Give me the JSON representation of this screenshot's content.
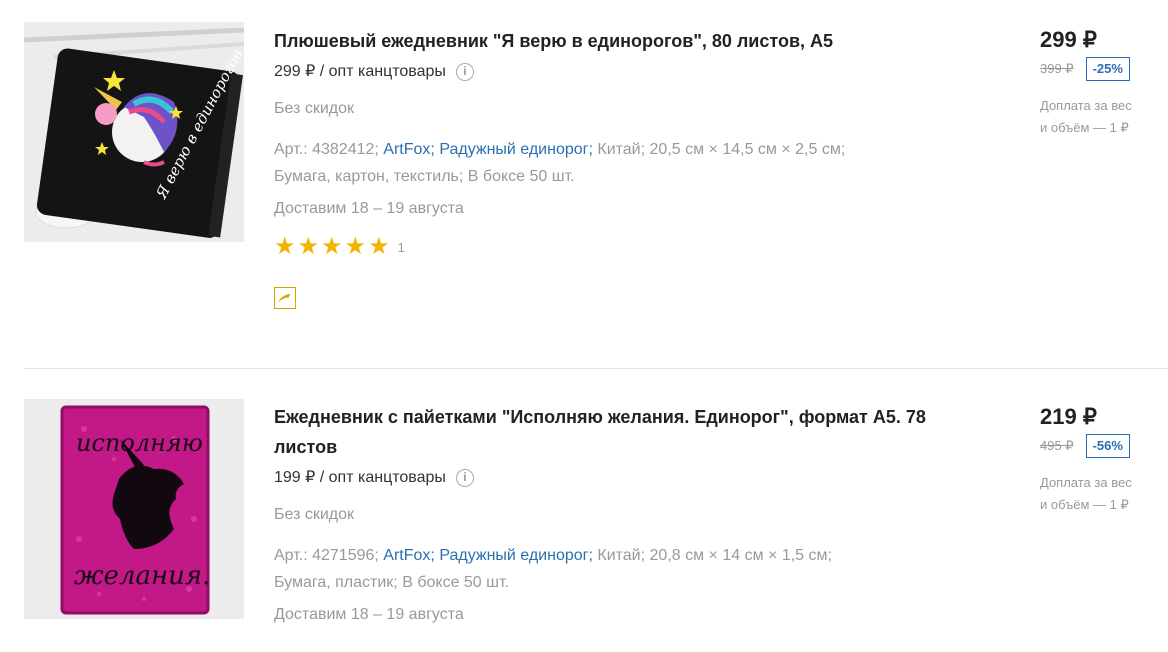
{
  "products": [
    {
      "title": "Плюшевый ежедневник \"Я верю в единорогов\", 80 листов, А5",
      "wholesale": "299 ₽ / опт канцтовары",
      "discount_text": "Без скидок",
      "article": "Арт.: 4382412;",
      "brand": "ArtFox;",
      "series": "Радужный единорог;",
      "country": "Китай;",
      "dimensions": "20,5 см × 14,5 см × 2,5 см;",
      "material": "Бумага, картон, текстиль;",
      "box": "В боксе 50 шт.",
      "delivery": "Доставим 18 – 19 августа",
      "rating": 5,
      "reviews": "1",
      "price": "299 ₽",
      "old_price": "399 ₽",
      "discount_badge": "-25%",
      "extra_line1": "Доплата за вес",
      "extra_line2": "и объём — 1 ₽",
      "image_text": "Я верю в единорогов"
    },
    {
      "title": "Ежедневник с пайетками \"Исполняю желания. Единорог\", формат А5. 78 листов",
      "wholesale": "199 ₽ / опт канцтовары",
      "discount_text": "Без скидок",
      "article": "Арт.: 4271596;",
      "brand": "ArtFox;",
      "series": "Радужный единорог;",
      "country": "Китай;",
      "dimensions": "20,8 см × 14 см × 1,5 см;",
      "material": "Бумага, пластик;",
      "box": "В боксе 50 шт.",
      "delivery": "Доставим 18 – 19 августа",
      "price": "219 ₽",
      "old_price": "495 ₽",
      "discount_badge": "-56%",
      "extra_line1": "Доплата за вес",
      "extra_line2": "и объём — 1 ₽",
      "image_text_top": "исполняю",
      "image_text_bottom": "желания."
    }
  ],
  "colors": {
    "link": "#2a6fb3",
    "star": "#f5b301",
    "muted": "#999999"
  }
}
